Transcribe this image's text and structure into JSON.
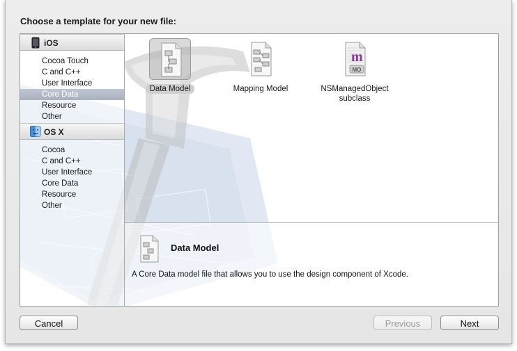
{
  "dialog": {
    "heading": "Choose a template for your new file:"
  },
  "sidebar": {
    "groups": [
      {
        "title": "iOS",
        "icon": "iphone-icon",
        "items": [
          "Cocoa Touch",
          "C and C++",
          "User Interface",
          "Core Data",
          "Resource",
          "Other"
        ]
      },
      {
        "title": "OS X",
        "icon": "finder-icon",
        "items": [
          "Cocoa",
          "C and C++",
          "User Interface",
          "Core Data",
          "Resource",
          "Other"
        ]
      }
    ],
    "selected": "iOS / Core Data"
  },
  "templates": [
    {
      "name": "Data Model",
      "icon": "data-model-document-icon",
      "selected": true
    },
    {
      "name": "Mapping Model",
      "icon": "mapping-model-document-icon",
      "selected": false
    },
    {
      "name": "NSManagedObject subclass",
      "line1": "NSManagedObject",
      "line2": "subclass",
      "icon": "managed-object-class-icon",
      "badge": "MO",
      "glyph": "m",
      "selected": false
    }
  ],
  "description": {
    "title": "Data Model",
    "text": "A Core Data model file that allows you to use the design component of Xcode."
  },
  "buttons": {
    "cancel": "Cancel",
    "previous": "Previous",
    "next": "Next"
  },
  "colors": {
    "selection": "#b3bac7",
    "accent_purple": "#8a3b9a"
  }
}
